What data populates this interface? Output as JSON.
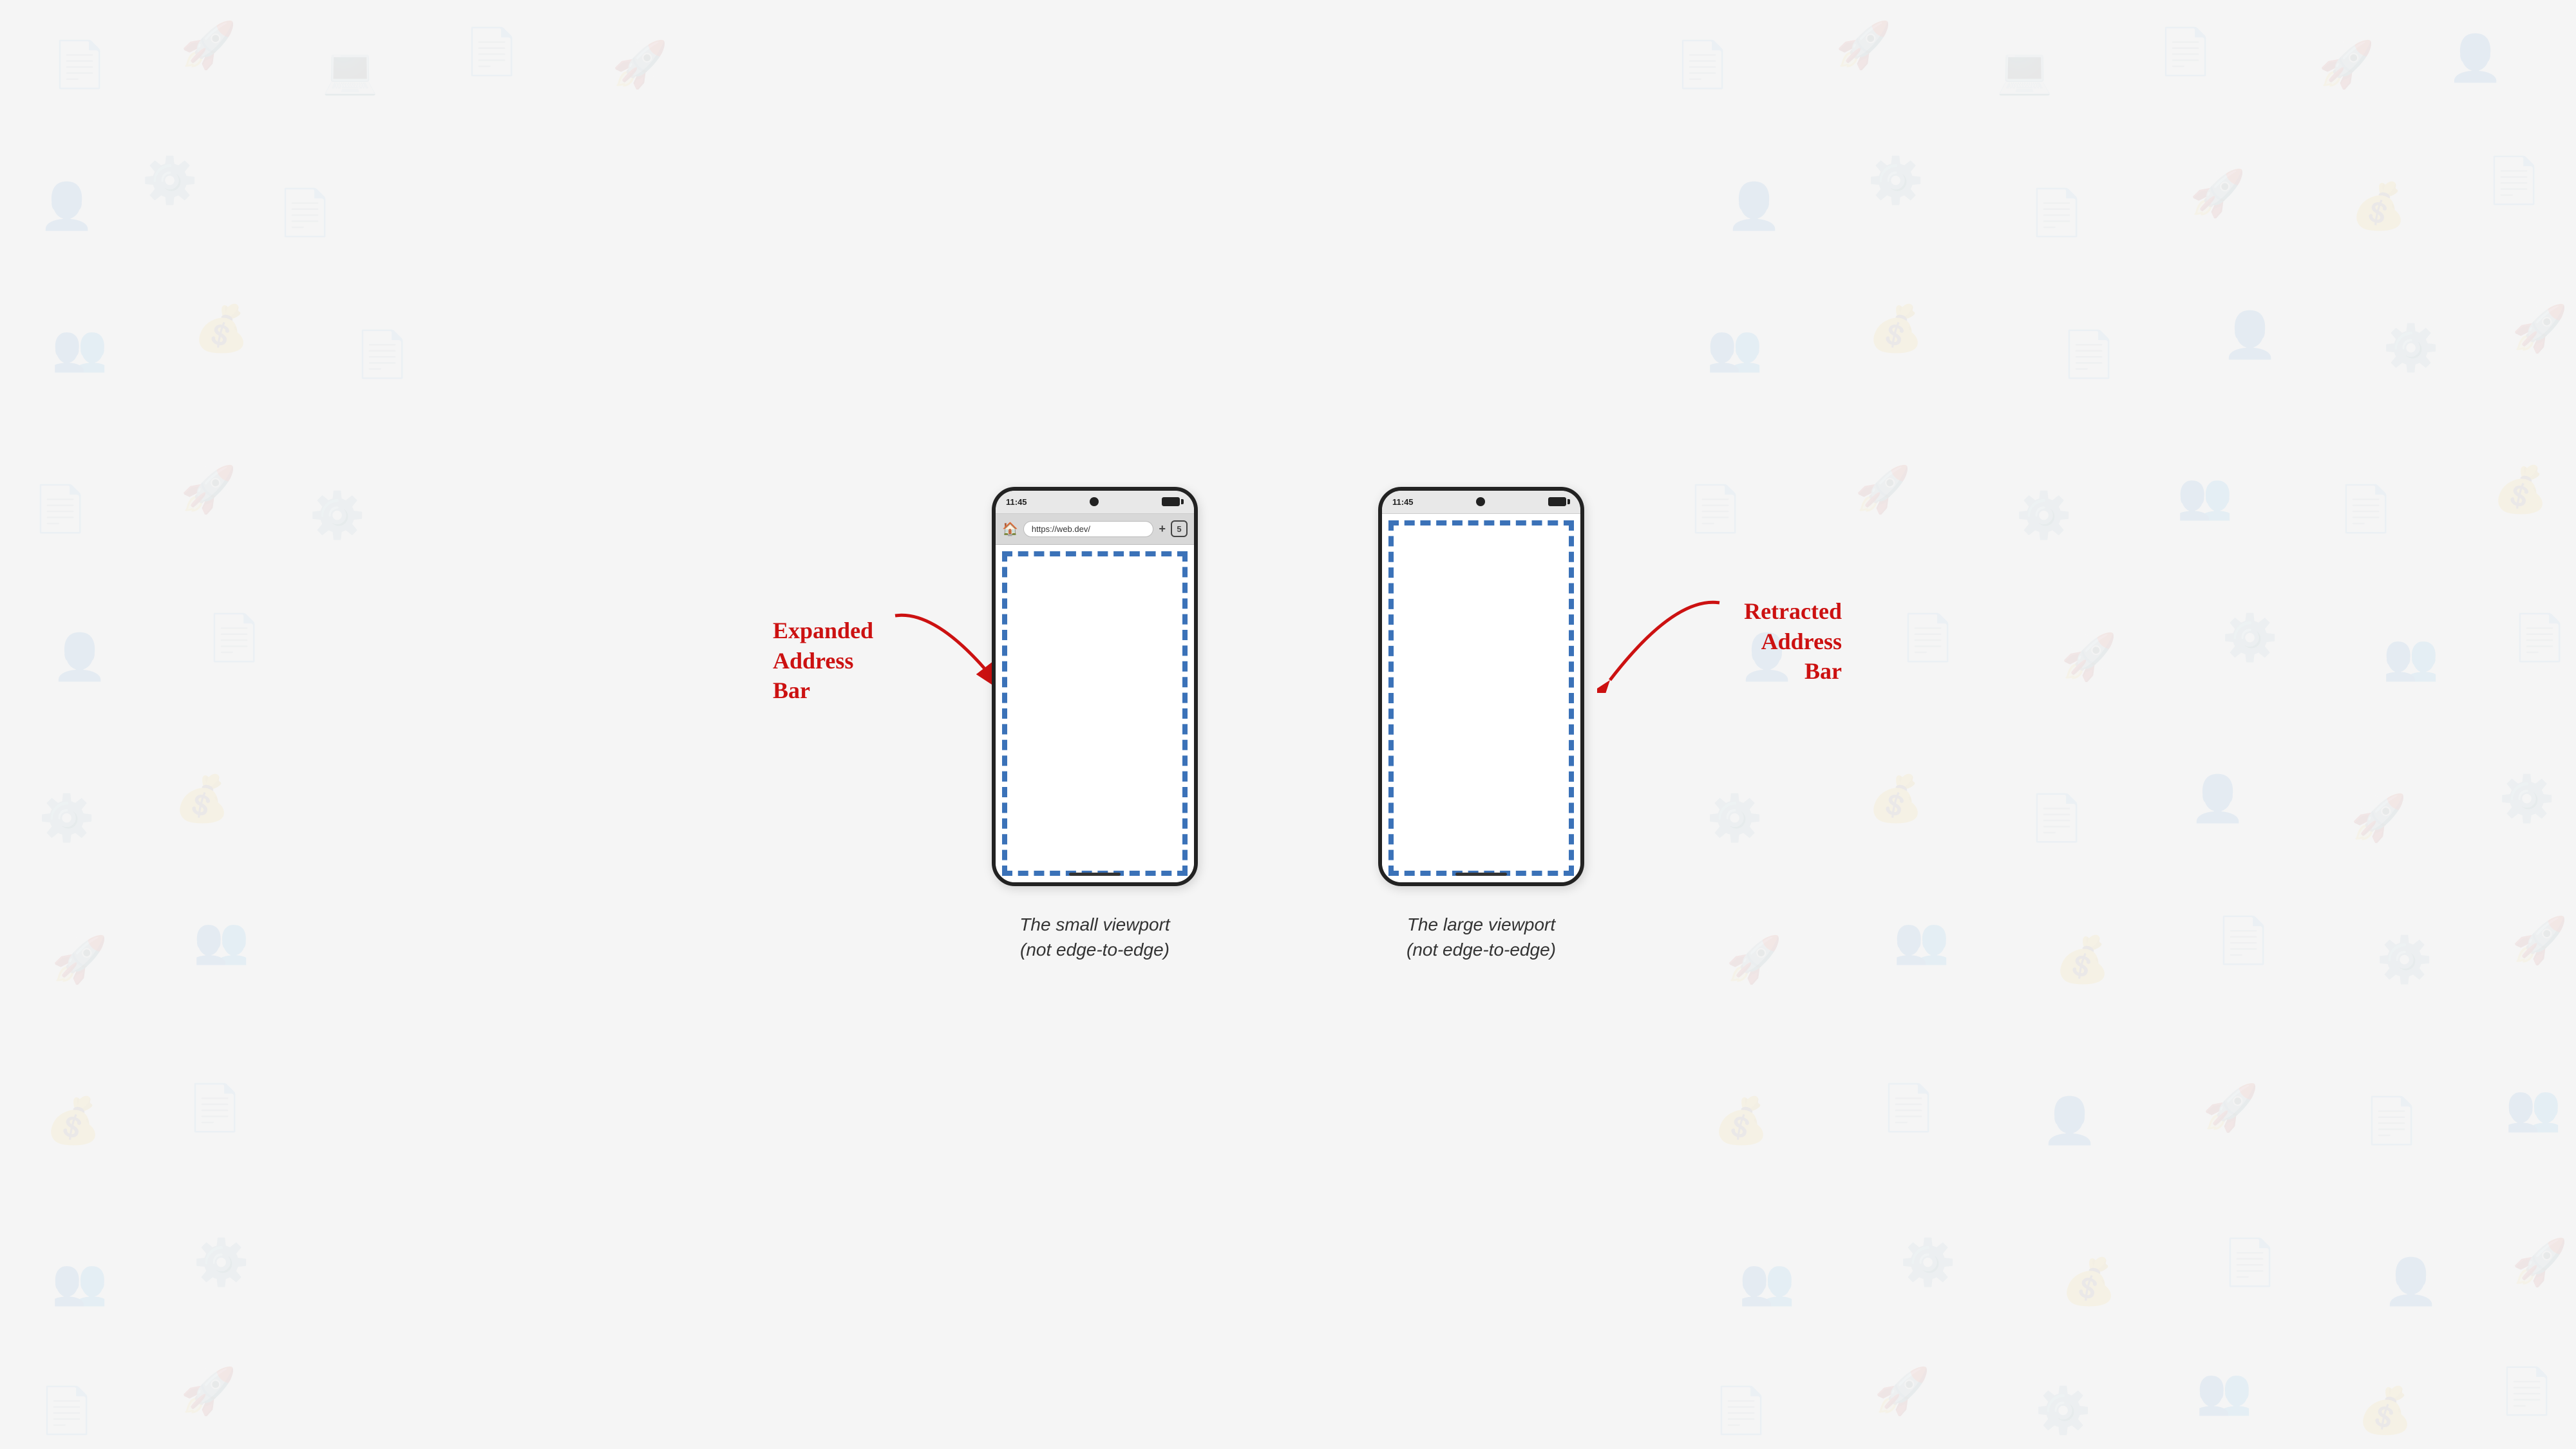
{
  "background": {
    "color": "#f5f5f5"
  },
  "leftPhone": {
    "statusTime": "11:45",
    "urlText": "https://web.dev/",
    "tabCount": "5",
    "hasAddressBar": true,
    "caption1": "The small viewport",
    "caption2": "(not edge-to-edge)"
  },
  "rightPhone": {
    "statusTime": "11:45",
    "hasAddressBar": false,
    "caption1": "The large viewport",
    "caption2": "(not edge-to-edge)"
  },
  "annotations": {
    "expanded": {
      "line1": "Expanded",
      "line2": "Address",
      "line3": "Bar"
    },
    "retracted": {
      "line1": "Retracted",
      "line2": "Address",
      "line3": "Bar"
    }
  }
}
